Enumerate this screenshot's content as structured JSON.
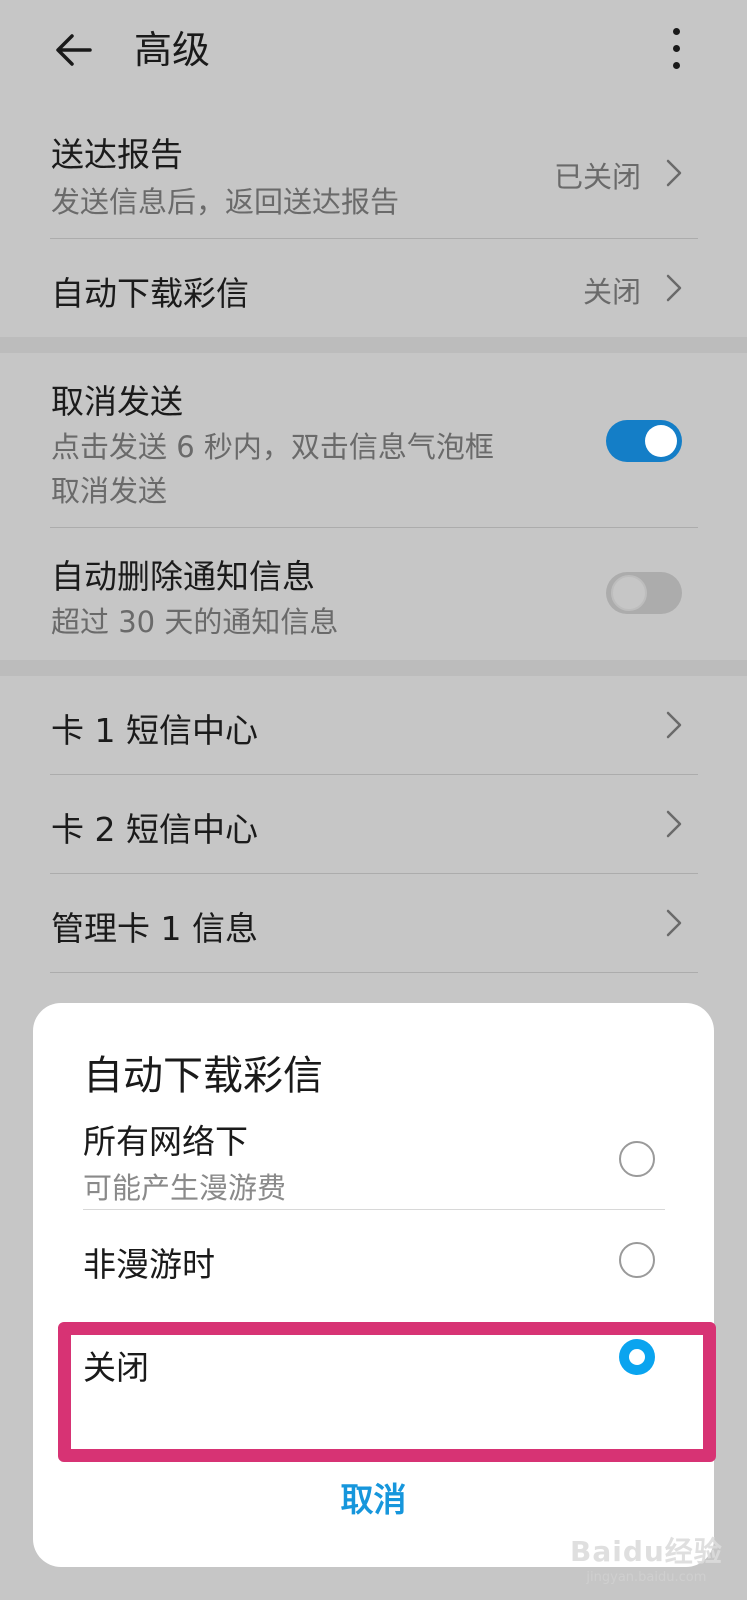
{
  "header": {
    "title": "高级",
    "back_icon": "arrow-left-icon",
    "more_icon": "more-vertical-icon"
  },
  "settings": {
    "delivery_report": {
      "label": "送达报告",
      "sub": "发送信息后，返回送达报告",
      "value": "已关闭"
    },
    "auto_download_mms": {
      "label": "自动下载彩信",
      "value": "关闭"
    },
    "cancel_send": {
      "label": "取消发送",
      "sub_line1": "点击发送 6 秒内，双击信息气泡框",
      "sub_line2": "取消发送",
      "enabled": true
    },
    "auto_delete": {
      "label": "自动删除通知信息",
      "sub": "超过 30 天的通知信息",
      "enabled": false
    },
    "sim1_center": {
      "label": "卡 1 短信中心"
    },
    "sim2_center": {
      "label": "卡 2 短信中心"
    },
    "manage_sim1": {
      "label": "管理卡 1 信息"
    }
  },
  "dialog": {
    "title": "自动下载彩信",
    "options": [
      {
        "label": "所有网络下",
        "sub": "可能产生漫游费",
        "selected": false
      },
      {
        "label": "非漫游时",
        "selected": false
      },
      {
        "label": "关闭",
        "selected": true
      }
    ],
    "cancel_label": "取消"
  },
  "watermark": {
    "brand": "Baidu经验",
    "url": "jingyan.baidu.com"
  },
  "colors": {
    "accent": "#0aa4ef",
    "toggle_on": "#147ec7",
    "highlight_frame": "#d73374",
    "background": "#c6c6c6",
    "cancel_text": "#1696dc"
  }
}
